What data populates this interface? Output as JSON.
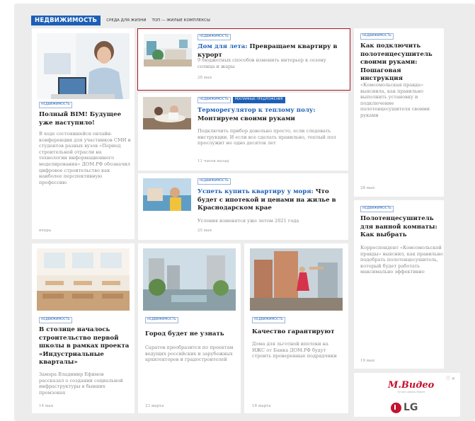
{
  "nav": {
    "section": "НЕДВИЖИМОСТЬ",
    "links": [
      "СРЕДА ДЛЯ ЖИЗНИ",
      "ТОП — ЖИЛЫЕ КОМПЛЕКСЫ"
    ]
  },
  "cards": {
    "bim": {
      "tag": "НЕДВИЖИМОСТЬ",
      "title": "Полный BIM! Будущее уже наступило!",
      "desc": "В ходе состоявшейся онлайн-конференции для участников СМИ и студентов разных вузов «Период строительной отрасли на технологии информационного моделирования» ДОМ.РФ обозначил цифровое строительство как наиболее перспективную профессию",
      "date": "вчера"
    },
    "dacha": {
      "tag": "НЕДВИЖИМОСТЬ",
      "title_hl": "Дом для лета:",
      "title": " Превращаем квартиру в курорт",
      "desc": "9 бюджетных способов изменить интерьер к сезону солнца и жары",
      "date": "28 мая"
    },
    "thermo": {
      "tags": [
        "НЕДВИЖИМОСТЬ",
        "РЕКЛАМНЫЕ ПРЕДЛОЖЕНИЯ"
      ],
      "title_hl": "Терморегулятор к теплому полу:",
      "title": " Монтируем своими руками",
      "desc": "Подключить прибор довольно просто, если следовать инструкции. И если все сделать правильно, теплый пол прослужит не одно десяток лет",
      "date": "11 часов назад"
    },
    "sea": {
      "tag": "НЕДВИЖИМОСТЬ",
      "title_hl": "Успеть купить квартиру у моря:",
      "title": " Что будет с ипотекой и ценами на жилье в Краснодарском крае",
      "desc": "Условия изменятся уже летом 2021 года",
      "date": "25 мая"
    },
    "towel1": {
      "tag": "НЕДВИЖИМОСТЬ",
      "title": "Как подключить полотенцесушитель своими руками: Пошаговая инструкция",
      "desc": "«Комсомольская правда» выяснила, как правильно выполнить установку и подключение полотенцесушителя своими руками",
      "date": "28 мая"
    },
    "towel2": {
      "tag": "НЕДВИЖИМОСТЬ",
      "title": "Полотенцесушитель для ванной комнаты: Как выбрать",
      "desc": "Корреспондент «Комсомольской правды» выяснил, как правильно подобрать полотенцесушитель, который будет работать максимально эффективно",
      "date": "19 мая"
    },
    "school": {
      "tag": "НЕДВИЖИМОСТЬ",
      "title": "В столице началось строительство первой школы в рамках проекта «Индустриальные кварталы»",
      "desc": "Замэра Владимир Ефимов рассказал о создании социальной инфраструктуры в бывших промзонах",
      "date": "14 мая"
    },
    "city": {
      "tag": "НЕДВИЖИМОСТЬ",
      "title": "Город будет не узнать",
      "desc": "Саратов преобразится по проектам ведущих российских и зарубежных архитекторов и градостроителей",
      "date": "23 марта"
    },
    "quality": {
      "tag": "НЕДВИЖИМОСТЬ",
      "title": "Качество гарантируют",
      "desc": "Дома для льготной ипотеки на ИЖС от Банка ДОМ.РФ будут строить проверенные подрядчики",
      "date": "18 марта"
    }
  },
  "ad": {
    "brand1": "М.Видео",
    "brand1_sub": "Лучше Цифры Ведем",
    "brand2": "LG",
    "close": "ⓘ ✕"
  }
}
